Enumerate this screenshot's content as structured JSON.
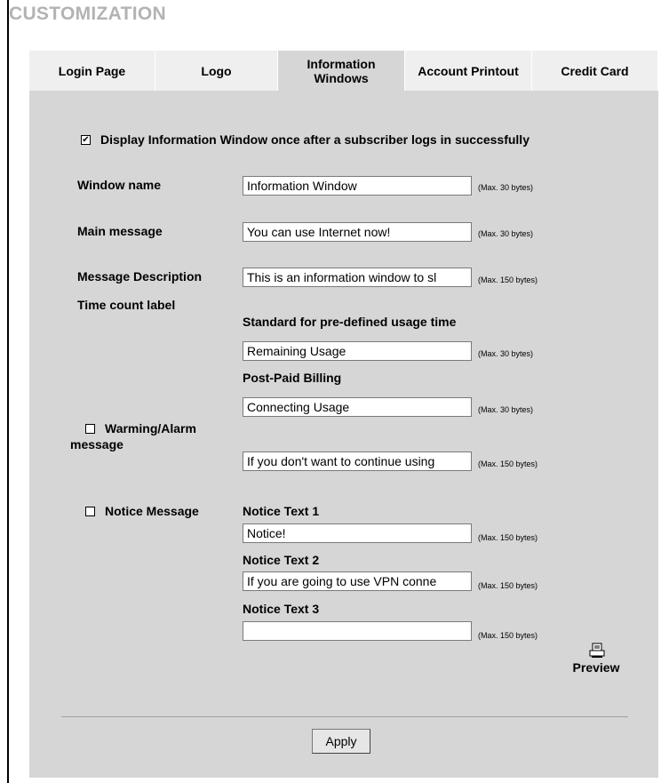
{
  "page": {
    "title": "CUSTOMIZATION"
  },
  "tabs": [
    {
      "label": "Login Page"
    },
    {
      "label": "Logo"
    },
    {
      "label": "Information\nWindows",
      "active": true
    },
    {
      "label": "Account Printout"
    },
    {
      "label": "Credit Card"
    }
  ],
  "form": {
    "display_info": {
      "label": "Display Information Window once after a subscriber logs in successfully",
      "checked": true
    },
    "window_name": {
      "label": "Window name",
      "value": "Information Window",
      "hint": "(Max. 30 bytes)"
    },
    "main_message": {
      "label": "Main message",
      "value": "You can use Internet now!",
      "hint": "(Max. 30 bytes)"
    },
    "message_description": {
      "label": "Message Description",
      "value": "This is an information window to sl",
      "hint": "(Max. 150 bytes)"
    },
    "time_count": {
      "label": "Time count label",
      "standard_label": "Standard for pre-defined usage time",
      "standard_value": "Remaining Usage",
      "standard_hint": "(Max. 30 bytes)",
      "postpaid_label": "Post-Paid Billing",
      "postpaid_value": "Connecting Usage",
      "postpaid_hint": "(Max. 30 bytes)"
    },
    "warning": {
      "label_line1": "Warming/Alarm",
      "label_line2": "message",
      "checked": false,
      "value": "If you don't want to continue using",
      "hint": "(Max. 150 bytes)"
    },
    "notice": {
      "label": "Notice Message",
      "checked": false,
      "text1_label": "Notice Text 1",
      "text1_value": "Notice!",
      "text1_hint": "(Max. 150 bytes)",
      "text2_label": "Notice Text 2",
      "text2_value": "If you are going to use VPN conne",
      "text2_hint": "(Max. 150 bytes)",
      "text3_label": "Notice Text 3",
      "text3_value": "",
      "text3_hint": "(Max. 150 bytes)"
    }
  },
  "preview": {
    "label": "Preview",
    "icon": "printer-icon"
  },
  "actions": {
    "apply_label": "Apply"
  },
  "colors": {
    "title": "#b3b3b3",
    "panel": "#d6d6d6",
    "tab": "#efefef"
  }
}
